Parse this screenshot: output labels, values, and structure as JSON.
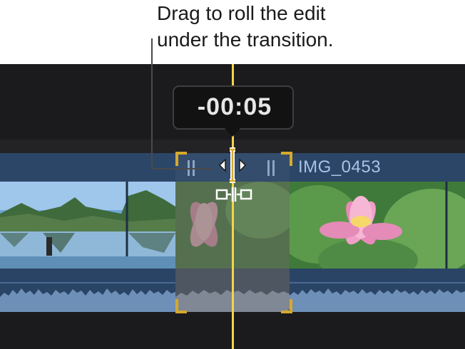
{
  "callout": {
    "line1": "Drag to roll the edit",
    "line2": "under the transition."
  },
  "timecode": "-00:05",
  "clips": {
    "right_name": "IMG_0453"
  },
  "colors": {
    "playhead": "#f5d34a",
    "selection": "#d6a92c",
    "clip": "#2f4a6f"
  },
  "icons": [
    "roll-edit-pointer-icon",
    "trim-handle-icon",
    "pause-marker-icon"
  ]
}
